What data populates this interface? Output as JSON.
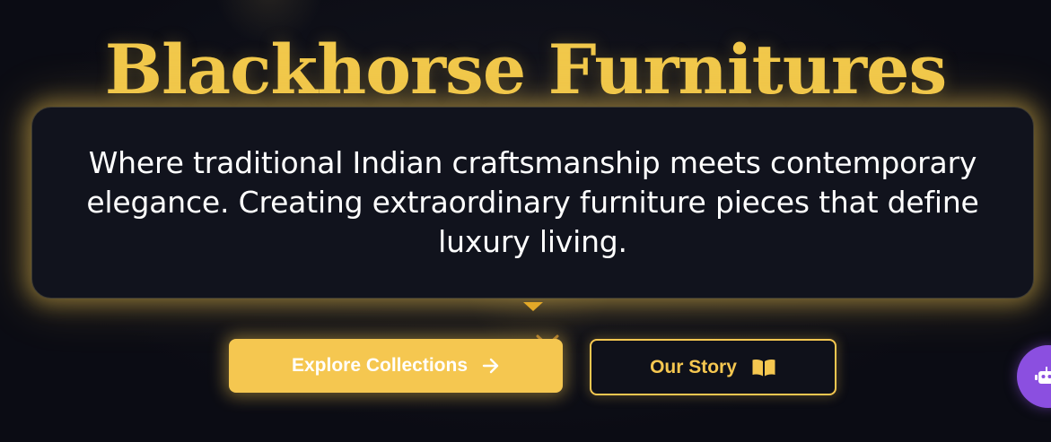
{
  "hero": {
    "title": "Blackhorse Furnitures",
    "tagline": "Where traditional Indian craftsmanship meets contemporary elegance. Creating extraordinary furniture pieces that define luxury living."
  },
  "actions": {
    "explore_label": "Explore Collections",
    "explore_icon": "arrow-right-icon",
    "story_label": "Our Story",
    "story_icon": "book-open-icon"
  },
  "chat": {
    "icon": "robot-icon"
  },
  "colors": {
    "accent_gold": "#f5c750",
    "background": "#0b0c14",
    "card": "#11131d",
    "chat_purple": "#8b4fe0"
  }
}
